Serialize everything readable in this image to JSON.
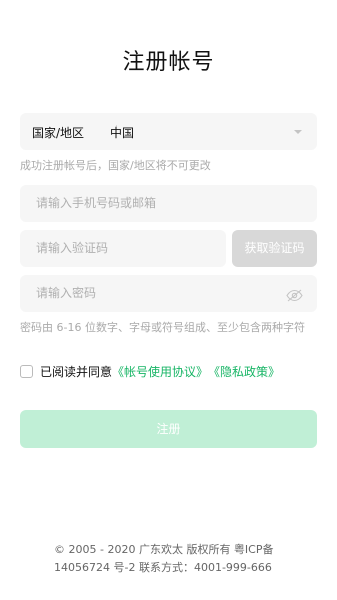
{
  "header": {
    "title": "注册帐号"
  },
  "region": {
    "label": "国家/地区",
    "value": "中国",
    "hint": "成功注册帐号后，国家/地区将不可更改"
  },
  "phone": {
    "placeholder": "请输入手机号码或邮箱"
  },
  "code": {
    "placeholder": "请输入验证码",
    "get_code_label": "获取验证码"
  },
  "password": {
    "placeholder": "请输入密码",
    "hint": "密码由 6-16 位数字、字母或符号组成、至少包含两种字符"
  },
  "agreement": {
    "text": "已阅读并同意",
    "terms_link": "《帐号使用协议》",
    "privacy_link": "《隐私政策》"
  },
  "submit": {
    "label": "注册"
  },
  "footer": {
    "copyright": "© 2005 - 2020 广东欢太 版权所有 粤ICP备14056724 号-2 联系方式：4001-999-666"
  },
  "colors": {
    "accent": "#17b565",
    "submit_disabled_bg": "#c0efd6",
    "button_disabled_bg": "#d8d8d8",
    "field_bg": "#f6f6f6"
  },
  "icons": {
    "dropdown": "caret-down-icon",
    "password_visibility": "eye-closed-icon"
  }
}
